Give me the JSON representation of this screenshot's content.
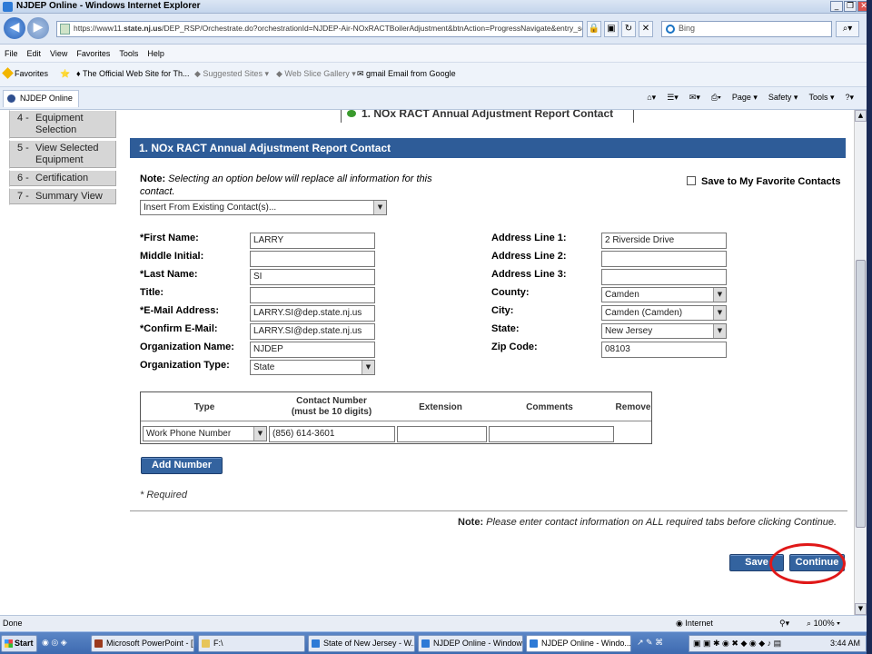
{
  "window": {
    "title": "NJDEP Online - Windows Internet Explorer"
  },
  "address": {
    "url_prefix": "https://www11.",
    "url_domain": "state.nj.us",
    "url_path": "/DEP_RSP/Orchestrate.do?orchestrationId=NJDEP-Air-NOxRACTBoilerAdjustment&btnAction=ProgressNavigate&entry_seq_id=",
    "search_placeholder": "Bing"
  },
  "menu": [
    "File",
    "Edit",
    "View",
    "Favorites",
    "Tools",
    "Help"
  ],
  "favorites": {
    "label": "Favorites",
    "items": [
      "The Official Web Site for Th...",
      "Suggested Sites ▾",
      "Web Slice Gallery ▾",
      "gmail Email from Google"
    ]
  },
  "tab": {
    "title": "NJDEP Online"
  },
  "commands": [
    "Page ▾",
    "Safety ▾",
    "Tools ▾"
  ],
  "leftnav": [
    {
      "num": "4 -",
      "label": "Equipment Selection"
    },
    {
      "num": "5 -",
      "label": "View Selected Equipment"
    },
    {
      "num": "6 -",
      "label": "Certification"
    },
    {
      "num": "7 -",
      "label": "Summary View"
    }
  ],
  "top_header": "1. NOx RACT Annual Adjustment Report Contact",
  "panel_title": "1. NOx RACT Annual Adjustment Report Contact",
  "note": {
    "bold": "Note:",
    "text": " Selecting an option below will replace all information for this contact."
  },
  "save_favorite": "Save to My Favorite Contacts",
  "insert_select": "Insert From Existing Contact(s)...",
  "form_left": [
    {
      "label": "*First Name:",
      "value": "LARRY"
    },
    {
      "label": "Middle Initial:",
      "value": ""
    },
    {
      "label": "*Last Name:",
      "value": "SI"
    },
    {
      "label": "Title:",
      "value": ""
    },
    {
      "label": "*E-Mail Address:",
      "value": "LARRY.SI@dep.state.nj.us"
    },
    {
      "label": "*Confirm E-Mail:",
      "value": "LARRY.SI@dep.state.nj.us"
    },
    {
      "label": "Organization Name:",
      "value": "NJDEP"
    },
    {
      "label": "Organization Type:",
      "value": "State"
    }
  ],
  "form_right": [
    {
      "label": "Address Line 1:",
      "value": "2 Riverside Drive"
    },
    {
      "label": "Address Line 2:",
      "value": ""
    },
    {
      "label": "Address Line 3:",
      "value": ""
    },
    {
      "label": "County:",
      "value": "Camden"
    },
    {
      "label": "City:",
      "value": "Camden (Camden)"
    },
    {
      "label": "State:",
      "value": "New Jersey"
    },
    {
      "label": "Zip Code:",
      "value": "08103"
    }
  ],
  "numbers_table": {
    "headers": [
      "Type",
      "Contact Number\n(must be 10 digits)",
      "Extension",
      "Comments",
      "Remove"
    ],
    "row": {
      "type": "Work Phone Number",
      "number": "(856) 614-3601",
      "extension": "",
      "comments": ""
    }
  },
  "add_number": "Add Number",
  "required": "* Required",
  "bottom_note": {
    "bold": "Note:",
    "text": " Please enter contact information on ALL required tabs before clicking Continue."
  },
  "save_button": "Save",
  "continue_button": "Continue",
  "status": {
    "left": "Done",
    "zone": "Internet",
    "zoom": "100%"
  },
  "taskbar": {
    "start": "Start",
    "tasks": [
      "Microsoft PowerPoint - [...",
      "F:\\",
      "State of New Jersey - W...",
      "NJDEP Online - Windows...",
      "NJDEP Online - Windo..."
    ],
    "clock": "3:44 AM"
  },
  "colors": {
    "panel_header": "#2e5c98",
    "button": "#33639f",
    "highlight_circle": "#e01818"
  }
}
